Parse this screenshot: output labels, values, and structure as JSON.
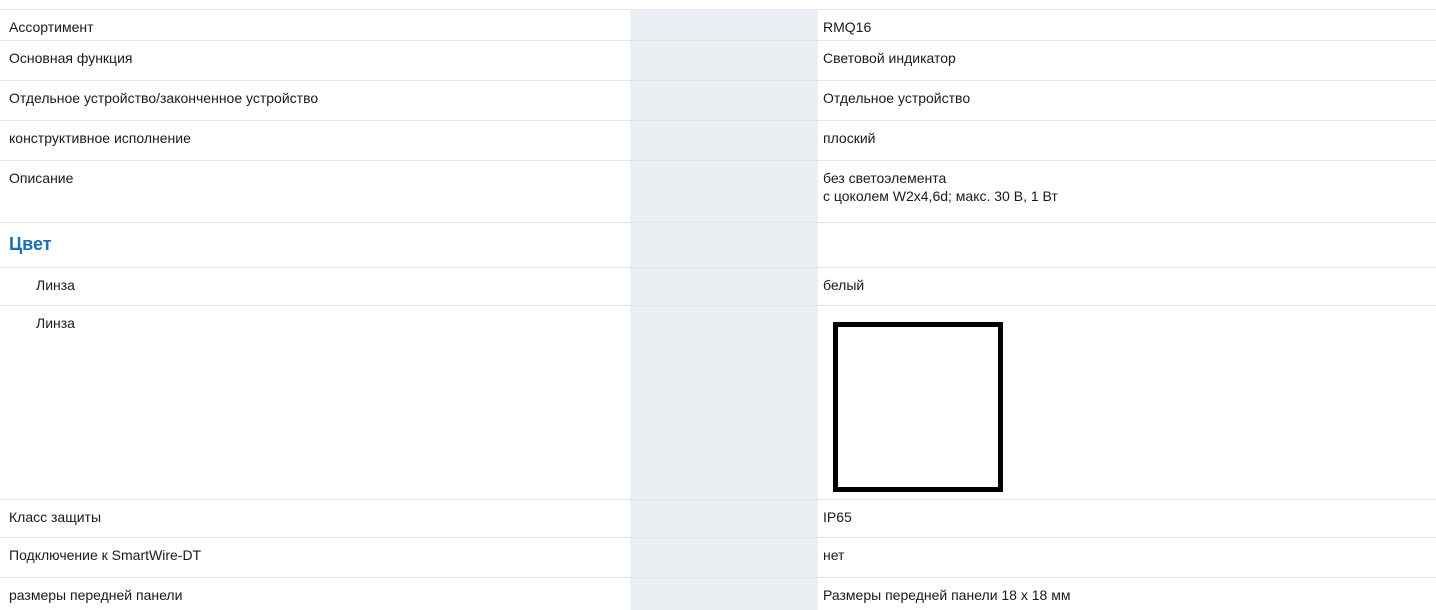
{
  "rows": [
    {
      "label": "Ассортимент",
      "value": "RMQ16"
    },
    {
      "label": "Основная функция",
      "value": "Световой индикатор"
    },
    {
      "label": "Отдельное устройство/законченное устройство",
      "value": "Отдельное устройство"
    },
    {
      "label": "конструктивное исполнение",
      "value": "плоский"
    },
    {
      "label": "Описание",
      "value_line1": "без светоэлемента",
      "value_line2": "с цоколем W2x4,6d; макс. 30 В, 1 Вт"
    }
  ],
  "color_section": {
    "title": "Цвет",
    "rows": [
      {
        "label": "Линза",
        "value": "белый"
      },
      {
        "label": "Линза",
        "swatch_color": "#ffffff"
      }
    ]
  },
  "rows_after": [
    {
      "label": "Класс защиты",
      "value": "IP65"
    },
    {
      "label": "Подключение к SmartWire-DT",
      "value": "нет"
    },
    {
      "label": "размеры передней панели",
      "value": "Размеры передней панели 18 x 18 мм"
    }
  ],
  "colors": {
    "heading_blue": "#1a6fb5",
    "mid_column_bg": "#ebeef2",
    "row_border": "#e2e5e9"
  }
}
